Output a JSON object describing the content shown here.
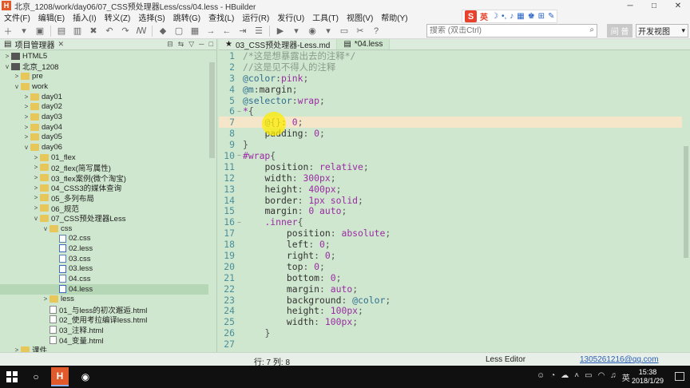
{
  "window": {
    "app_icon": "H",
    "title": "北京_1208/work/day06/07_CSS预处理器Less/css/04.less - HBuilder",
    "controls": [
      "─",
      "□",
      "✕"
    ]
  },
  "menu": [
    "文件(F)",
    "编辑(E)",
    "插入(I)",
    "转义(Z)",
    "选择(S)",
    "跳转(G)",
    "查找(L)",
    "运行(R)",
    "发行(U)",
    "工具(T)",
    "视图(V)",
    "帮助(Y)"
  ],
  "ime": {
    "logo": "S",
    "lang": "英"
  },
  "toolbar": {
    "search_placeholder": "搜索 (双击Ctrl)",
    "login_label": "间 普",
    "view_label": "开发视图"
  },
  "project_panel": {
    "tab_label": "项目管理器",
    "tree": [
      {
        "depth": 0,
        "twisty": ">",
        "icon": "project",
        "label": "HTML5"
      },
      {
        "depth": 0,
        "twisty": "v",
        "icon": "project",
        "label": "北京_1208"
      },
      {
        "depth": 1,
        "twisty": ">",
        "icon": "folder",
        "label": "pre"
      },
      {
        "depth": 1,
        "twisty": "v",
        "icon": "folder",
        "label": "work"
      },
      {
        "depth": 2,
        "twisty": ">",
        "icon": "folder",
        "label": "day01"
      },
      {
        "depth": 2,
        "twisty": ">",
        "icon": "folder",
        "label": "day02"
      },
      {
        "depth": 2,
        "twisty": ">",
        "icon": "folder",
        "label": "day03"
      },
      {
        "depth": 2,
        "twisty": ">",
        "icon": "folder",
        "label": "day04"
      },
      {
        "depth": 2,
        "twisty": ">",
        "icon": "folder",
        "label": "day05"
      },
      {
        "depth": 2,
        "twisty": "v",
        "icon": "folder",
        "label": "day06"
      },
      {
        "depth": 3,
        "twisty": ">",
        "icon": "folder",
        "label": "01_flex"
      },
      {
        "depth": 3,
        "twisty": ">",
        "icon": "folder",
        "label": "02_flex(简写属性)"
      },
      {
        "depth": 3,
        "twisty": ">",
        "icon": "folder",
        "label": "03_flex案例(微个淘宝)"
      },
      {
        "depth": 3,
        "twisty": ">",
        "icon": "folder",
        "label": "04_CSS3的媒体查询"
      },
      {
        "depth": 3,
        "twisty": ">",
        "icon": "folder",
        "label": "05_多列布局"
      },
      {
        "depth": 3,
        "twisty": ">",
        "icon": "folder",
        "label": "06_规范"
      },
      {
        "depth": 3,
        "twisty": "v",
        "icon": "folder",
        "label": "07_CSS预处理器Less"
      },
      {
        "depth": 4,
        "twisty": "v",
        "icon": "folder",
        "label": "css"
      },
      {
        "depth": 5,
        "twisty": "",
        "icon": "file",
        "label": "02.css"
      },
      {
        "depth": 5,
        "twisty": "",
        "icon": "file-less",
        "label": "02.less"
      },
      {
        "depth": 5,
        "twisty": "",
        "icon": "file",
        "label": "03.css"
      },
      {
        "depth": 5,
        "twisty": "",
        "icon": "file-less",
        "label": "03.less"
      },
      {
        "depth": 5,
        "twisty": "",
        "icon": "file",
        "label": "04.css"
      },
      {
        "depth": 5,
        "twisty": "",
        "icon": "file-less",
        "label": "04.less",
        "selected": true
      },
      {
        "depth": 4,
        "twisty": ">",
        "icon": "folder",
        "label": "less"
      },
      {
        "depth": 4,
        "twisty": "",
        "icon": "file-html",
        "label": "01_与less的初次邂逅.html"
      },
      {
        "depth": 4,
        "twisty": "",
        "icon": "file-html",
        "label": "02_使用考拉编译less.html"
      },
      {
        "depth": 4,
        "twisty": "",
        "icon": "file-html",
        "label": "03_注释.html"
      },
      {
        "depth": 4,
        "twisty": "",
        "icon": "file-html",
        "label": "04_变量.html"
      },
      {
        "depth": 1,
        "twisty": ">",
        "icon": "folder",
        "label": "课件"
      }
    ]
  },
  "editor": {
    "tabs": [
      {
        "label": "03_CSS预处理器-Less.md",
        "active": false,
        "prefix": "★"
      },
      {
        "label": "*04.less",
        "active": true,
        "prefix": "▤"
      }
    ],
    "lines": [
      {
        "n": "1",
        "fold": "",
        "segments": [
          [
            "c-comment",
            "/*这是想暴露出去的注释*/"
          ]
        ]
      },
      {
        "n": "2",
        "fold": "",
        "segments": [
          [
            "c-comment",
            "//这是见不得人的注释"
          ]
        ]
      },
      {
        "n": "3",
        "fold": "",
        "segments": [
          [
            "c-at",
            "@color"
          ],
          [
            "c-punct",
            ":"
          ],
          [
            "c-val",
            "pink"
          ],
          [
            "c-punct",
            ";"
          ]
        ]
      },
      {
        "n": "4",
        "fold": "",
        "segments": [
          [
            "c-at",
            "@m"
          ],
          [
            "c-punct",
            ":"
          ],
          [
            "c-prop",
            "margin"
          ],
          [
            "c-punct",
            ";"
          ]
        ]
      },
      {
        "n": "5",
        "fold": "",
        "segments": [
          [
            "c-at",
            "@selector"
          ],
          [
            "c-punct",
            ":"
          ],
          [
            "c-val",
            "wrap"
          ],
          [
            "c-punct",
            ";"
          ]
        ]
      },
      {
        "n": "6",
        "fold": "−",
        "segments": [
          [
            "c-sel",
            "*"
          ],
          [
            "c-punct",
            "{"
          ]
        ]
      },
      {
        "n": "7",
        "fold": "",
        "current": true,
        "segments": [
          [
            "c-punct",
            "    "
          ],
          [
            "c-at",
            "@{}"
          ],
          [
            "c-punct",
            ": "
          ],
          [
            "c-num",
            "0"
          ],
          [
            "c-punct",
            ";"
          ]
        ]
      },
      {
        "n": "8",
        "fold": "",
        "segments": [
          [
            "c-punct",
            "    "
          ],
          [
            "c-prop",
            "padding"
          ],
          [
            "c-punct",
            ": "
          ],
          [
            "c-num",
            "0"
          ],
          [
            "c-punct",
            ";"
          ]
        ]
      },
      {
        "n": "9",
        "fold": "",
        "segments": [
          [
            "c-punct",
            "}"
          ]
        ]
      },
      {
        "n": "10",
        "fold": "−",
        "segments": [
          [
            "c-sel",
            "#wrap"
          ],
          [
            "c-punct",
            "{"
          ]
        ]
      },
      {
        "n": "11",
        "fold": "",
        "segments": [
          [
            "c-punct",
            "    "
          ],
          [
            "c-prop",
            "position"
          ],
          [
            "c-punct",
            ": "
          ],
          [
            "c-val",
            "relative"
          ],
          [
            "c-punct",
            ";"
          ]
        ]
      },
      {
        "n": "12",
        "fold": "",
        "segments": [
          [
            "c-punct",
            "    "
          ],
          [
            "c-prop",
            "width"
          ],
          [
            "c-punct",
            ": "
          ],
          [
            "c-num",
            "300px"
          ],
          [
            "c-punct",
            ";"
          ]
        ]
      },
      {
        "n": "13",
        "fold": "",
        "segments": [
          [
            "c-punct",
            "    "
          ],
          [
            "c-prop",
            "height"
          ],
          [
            "c-punct",
            ": "
          ],
          [
            "c-num",
            "400px"
          ],
          [
            "c-punct",
            ";"
          ]
        ]
      },
      {
        "n": "14",
        "fold": "",
        "segments": [
          [
            "c-punct",
            "    "
          ],
          [
            "c-prop",
            "border"
          ],
          [
            "c-punct",
            ": "
          ],
          [
            "c-num",
            "1px"
          ],
          [
            "c-punct",
            " "
          ],
          [
            "c-val",
            "solid"
          ],
          [
            "c-punct",
            ";"
          ]
        ]
      },
      {
        "n": "15",
        "fold": "",
        "segments": [
          [
            "c-punct",
            "    "
          ],
          [
            "c-prop",
            "margin"
          ],
          [
            "c-punct",
            ": "
          ],
          [
            "c-num",
            "0"
          ],
          [
            "c-punct",
            " "
          ],
          [
            "c-val",
            "auto"
          ],
          [
            "c-punct",
            ";"
          ]
        ]
      },
      {
        "n": "16",
        "fold": "−",
        "segments": [
          [
            "c-punct",
            "    "
          ],
          [
            "c-sel",
            ".inner"
          ],
          [
            "c-punct",
            "{"
          ]
        ]
      },
      {
        "n": "17",
        "fold": "",
        "segments": [
          [
            "c-punct",
            "        "
          ],
          [
            "c-prop",
            "position"
          ],
          [
            "c-punct",
            ": "
          ],
          [
            "c-val",
            "absolute"
          ],
          [
            "c-punct",
            ";"
          ]
        ]
      },
      {
        "n": "18",
        "fold": "",
        "segments": [
          [
            "c-punct",
            "        "
          ],
          [
            "c-prop",
            "left"
          ],
          [
            "c-punct",
            ": "
          ],
          [
            "c-num",
            "0"
          ],
          [
            "c-punct",
            ";"
          ]
        ]
      },
      {
        "n": "19",
        "fold": "",
        "segments": [
          [
            "c-punct",
            "        "
          ],
          [
            "c-prop",
            "right"
          ],
          [
            "c-punct",
            ": "
          ],
          [
            "c-num",
            "0"
          ],
          [
            "c-punct",
            ";"
          ]
        ]
      },
      {
        "n": "20",
        "fold": "",
        "segments": [
          [
            "c-punct",
            "        "
          ],
          [
            "c-prop",
            "top"
          ],
          [
            "c-punct",
            ": "
          ],
          [
            "c-num",
            "0"
          ],
          [
            "c-punct",
            ";"
          ]
        ]
      },
      {
        "n": "21",
        "fold": "",
        "segments": [
          [
            "c-punct",
            "        "
          ],
          [
            "c-prop",
            "bottom"
          ],
          [
            "c-punct",
            ": "
          ],
          [
            "c-num",
            "0"
          ],
          [
            "c-punct",
            ";"
          ]
        ]
      },
      {
        "n": "22",
        "fold": "",
        "segments": [
          [
            "c-punct",
            "        "
          ],
          [
            "c-prop",
            "margin"
          ],
          [
            "c-punct",
            ": "
          ],
          [
            "c-val",
            "auto"
          ],
          [
            "c-punct",
            ";"
          ]
        ]
      },
      {
        "n": "23",
        "fold": "",
        "segments": [
          [
            "c-punct",
            "        "
          ],
          [
            "c-prop",
            "background"
          ],
          [
            "c-punct",
            ": "
          ],
          [
            "c-at",
            "@color"
          ],
          [
            "c-punct",
            ";"
          ]
        ]
      },
      {
        "n": "24",
        "fold": "",
        "segments": [
          [
            "c-punct",
            "        "
          ],
          [
            "c-prop",
            "height"
          ],
          [
            "c-punct",
            ": "
          ],
          [
            "c-num",
            "100px"
          ],
          [
            "c-punct",
            ";"
          ]
        ]
      },
      {
        "n": "25",
        "fold": "",
        "segments": [
          [
            "c-punct",
            "        "
          ],
          [
            "c-prop",
            "width"
          ],
          [
            "c-punct",
            ": "
          ],
          [
            "c-num",
            "100px"
          ],
          [
            "c-punct",
            ";"
          ]
        ]
      },
      {
        "n": "26",
        "fold": "",
        "segments": [
          [
            "c-punct",
            "    "
          ],
          [
            "c-punct",
            "}"
          ]
        ]
      },
      {
        "n": "27",
        "fold": "",
        "segments": [
          [
            "c-punct",
            ""
          ]
        ]
      }
    ]
  },
  "status": {
    "position": "行: 7 列: 8",
    "mode": "Less Editor",
    "email": "1305261216@qq.com"
  },
  "taskbar": {
    "hb_label": "H",
    "time": "15:38",
    "date": "2018/1/29"
  }
}
